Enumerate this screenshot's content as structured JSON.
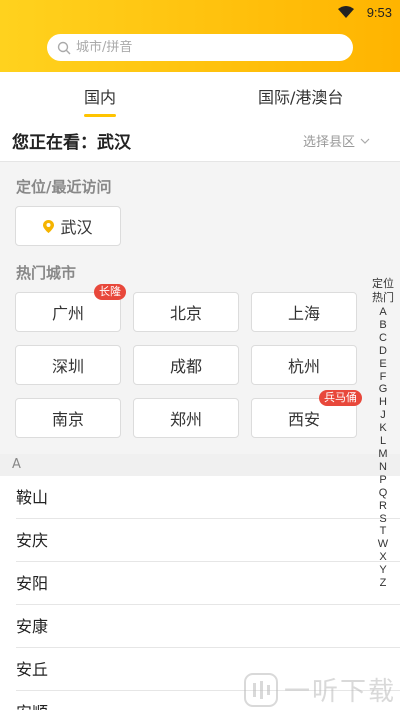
{
  "status": {
    "time": "9:53"
  },
  "search": {
    "placeholder": "城市/拼音"
  },
  "tabs": [
    {
      "label": "国内"
    },
    {
      "label": "国际/港澳台"
    }
  ],
  "current": {
    "label": "您正在看：",
    "city": "武汉",
    "county_select": "选择县区"
  },
  "recent": {
    "title": "定位/最近访问",
    "city": "武汉"
  },
  "hot": {
    "title": "热门城市",
    "cities": [
      {
        "name": "广州",
        "badge": "长隆"
      },
      {
        "name": "北京",
        "badge": ""
      },
      {
        "name": "上海",
        "badge": ""
      },
      {
        "name": "深圳",
        "badge": ""
      },
      {
        "name": "成都",
        "badge": ""
      },
      {
        "name": "杭州",
        "badge": ""
      },
      {
        "name": "南京",
        "badge": ""
      },
      {
        "name": "郑州",
        "badge": ""
      },
      {
        "name": "西安",
        "badge": "兵马俑"
      }
    ]
  },
  "list": {
    "letter": "A",
    "items": [
      "鞍山",
      "安庆",
      "安阳",
      "安康",
      "安丘",
      "安顺"
    ]
  },
  "index_bar": {
    "top": [
      "定位",
      "热门"
    ],
    "letters": [
      "A",
      "B",
      "C",
      "D",
      "E",
      "F",
      "G",
      "H",
      "J",
      "K",
      "L",
      "M",
      "N",
      "P",
      "Q",
      "R",
      "S",
      "T",
      "W",
      "X",
      "Y",
      "Z"
    ]
  },
  "watermark": {
    "text": "一听下载"
  },
  "colors": {
    "accent": "#ffc400",
    "badge": "#e8483b",
    "location_pin": "#f5b400"
  }
}
